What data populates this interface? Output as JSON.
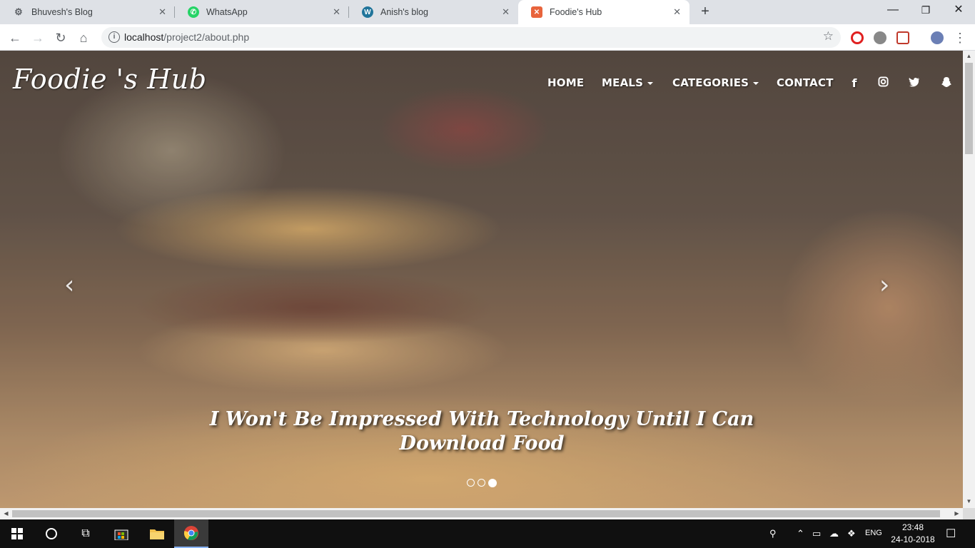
{
  "browser": {
    "tabs": [
      {
        "title": "Bhuvesh's Blog",
        "icon": "gear-favicon-icon",
        "active": false
      },
      {
        "title": "WhatsApp",
        "icon": "whatsapp-favicon-icon",
        "active": false
      },
      {
        "title": "Anish's blog",
        "icon": "wordpress-favicon-icon",
        "active": false
      },
      {
        "title": "Foodie's Hub",
        "icon": "foodie-favicon-icon",
        "active": true
      }
    ],
    "url_host": "localhost",
    "url_path": "/project2/about.php"
  },
  "site": {
    "brand": "Foodie 's Hub",
    "nav": {
      "home": "HOME",
      "meals": "MEALS",
      "categories": "CATEGORIES",
      "contact": "CONTACT"
    },
    "social": [
      "facebook-icon",
      "instagram-icon",
      "twitter-icon",
      "snapchat-icon"
    ],
    "caption": "I Won't Be Impressed With Technology Until I Can Download Food",
    "carousel": {
      "slides": 3,
      "active_slide": 3
    }
  },
  "taskbar": {
    "language": "ENG",
    "time": "23:48",
    "date": "24-10-2018"
  },
  "colors": {
    "tab_strip": "#dee1e6",
    "taskbar": "#101010",
    "whatsapp": "#25d366",
    "wordpress": "#21759b",
    "foodie": "#e8643c",
    "opera": "#e02020"
  }
}
